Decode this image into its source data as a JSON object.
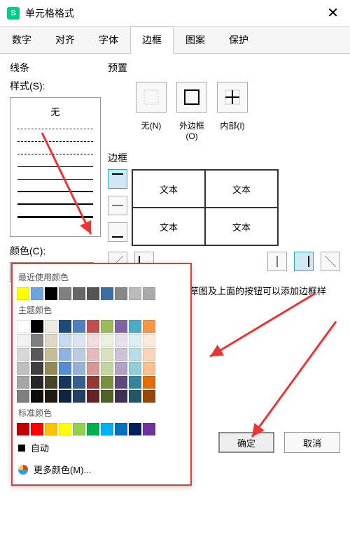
{
  "title": "单元格格式",
  "tabs": [
    "数字",
    "对齐",
    "字体",
    "边框",
    "图案",
    "保护"
  ],
  "active_tab": 3,
  "line_section": "线条",
  "style_label": "样式(S):",
  "style_none": "无",
  "color_label": "颜色(C):",
  "color_value": "自动",
  "preset_section": "预置",
  "presets": {
    "none": "无(N)",
    "outer": "外边框(O)",
    "inner": "内部(I)"
  },
  "border_section": "边框",
  "preview_text": "文本",
  "hint": "单击预置选项、预览草图及上面的按钮可以添加边框样式。",
  "ok": "确定",
  "cancel": "取消",
  "popup": {
    "recent": "最近使用颜色",
    "theme": "主题颜色",
    "standard": "标准颜色",
    "auto": "自动",
    "more": "更多颜色(M)..."
  },
  "colors": {
    "recent": [
      "#ffff00",
      "#6ca6dc",
      "#000000",
      "#808080",
      "#666666",
      "#555555",
      "#3b6ea5",
      "#888888",
      "#bbbbbb",
      "#aaaaaa"
    ],
    "theme_main": [
      "#ffffff",
      "#000000",
      "#eeece1",
      "#1f497d",
      "#4f81bd",
      "#c0504d",
      "#9bbb59",
      "#8064a2",
      "#4bacc6",
      "#f79646"
    ],
    "theme_shades": [
      [
        "#f2f2f2",
        "#7f7f7f",
        "#ddd9c3",
        "#c6d9f0",
        "#dbe5f1",
        "#f2dcdb",
        "#ebf1dd",
        "#e5e0ec",
        "#dbeef3",
        "#fdeada"
      ],
      [
        "#d8d8d8",
        "#595959",
        "#c4bd97",
        "#8db3e2",
        "#b8cce4",
        "#e5b9b7",
        "#d7e3bc",
        "#ccc1d9",
        "#b7dde8",
        "#fbd5b5"
      ],
      [
        "#bfbfbf",
        "#3f3f3f",
        "#938953",
        "#548dd4",
        "#95b3d7",
        "#d99694",
        "#c3d69b",
        "#b2a2c7",
        "#92cddc",
        "#fac08f"
      ],
      [
        "#a5a5a5",
        "#262626",
        "#494429",
        "#17365d",
        "#366092",
        "#953734",
        "#76923c",
        "#5f497a",
        "#31859b",
        "#e36c09"
      ],
      [
        "#7f7f7f",
        "#0c0c0c",
        "#1d1b10",
        "#0f243e",
        "#244061",
        "#632423",
        "#4f6128",
        "#3f3151",
        "#205867",
        "#974806"
      ]
    ],
    "standard": [
      "#c00000",
      "#ff0000",
      "#ffc000",
      "#ffff00",
      "#92d050",
      "#00b050",
      "#00b0f0",
      "#0070c0",
      "#002060",
      "#7030a0"
    ]
  }
}
